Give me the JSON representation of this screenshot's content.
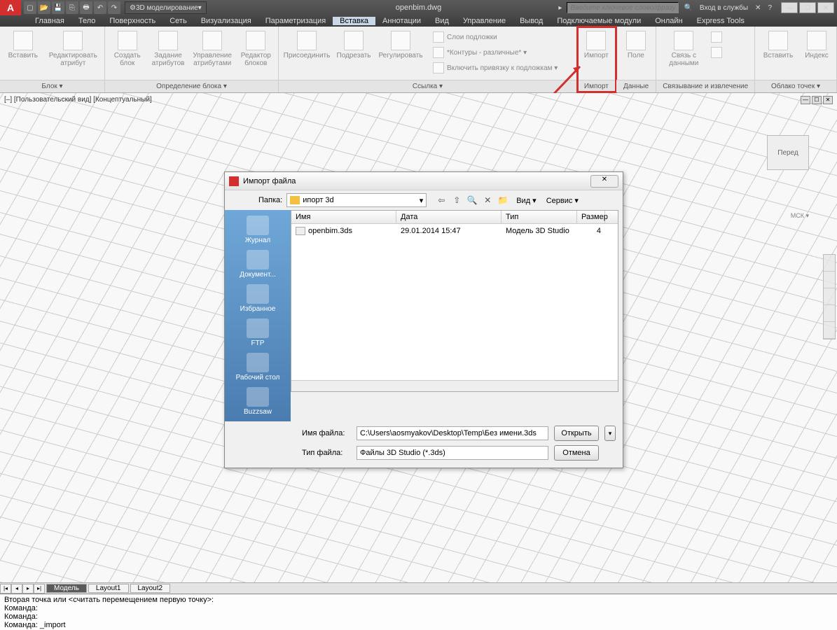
{
  "title": "openbim.dwg",
  "workspace": "3D моделирование",
  "search_placeholder": "Введите ключевое слово/фразу",
  "signin": "Вход в службы",
  "menu": [
    "Главная",
    "Тело",
    "Поверхность",
    "Сеть",
    "Визуализация",
    "Параметризация",
    "Вставка",
    "Аннотации",
    "Вид",
    "Управление",
    "Вывод",
    "Подключаемые модули",
    "Онлайн",
    "Express Tools"
  ],
  "active_menu": 6,
  "panels": {
    "block": {
      "title": "Блок ▾",
      "items": [
        "Вставить",
        "Редактировать атрибут"
      ]
    },
    "blockdef": {
      "title": "Определение блока ▾",
      "items": [
        "Создать блок",
        "Задание атрибутов",
        "Управление атрибутами",
        "Редактор блоков"
      ]
    },
    "ref": {
      "title": "Ссылка ▾",
      "items": [
        "Присоединить",
        "Подрезать",
        "Регулировать"
      ],
      "rows": [
        "Слои подложки",
        "*Контуры - различные* ▾",
        "Включить привязку к подложкам ▾"
      ]
    },
    "import": {
      "title": "Импорт",
      "item": "Импорт"
    },
    "data": {
      "title": "Данные",
      "item": "Поле"
    },
    "link": {
      "title": "Связывание и извлечение",
      "item": "Связь с данными"
    },
    "cloud": {
      "title": "Облако точек ▾",
      "items": [
        "Вставить",
        "Индекс"
      ]
    }
  },
  "viewport_label": "[–] [Пользовательский вид] [Концептуальный]",
  "viewcube": "Перед",
  "wcs": "МСК ▾",
  "dialog": {
    "title": "Импорт файла",
    "folder_label": "Папка:",
    "folder": "ипорт 3d",
    "view": "Вид",
    "service": "Сервис",
    "places": [
      "Журнал",
      "Документ...",
      "Избранное",
      "FTP",
      "Рабочий стол",
      "Buzzsaw"
    ],
    "cols": {
      "name": "Имя",
      "date": "Дата",
      "type": "Тип",
      "size": "Размер"
    },
    "rows": [
      {
        "name": "openbim.3ds",
        "date": "29.01.2014 15:47",
        "type": "Модель 3D Studio",
        "size": "4"
      }
    ],
    "filename_label": "Имя файла:",
    "filename": "C:\\Users\\aosmyakov\\Desktop\\Temp\\Без имени.3ds",
    "filetype_label": "Тип файла:",
    "filetype": "Файлы 3D Studio (*.3ds)",
    "open": "Открыть",
    "cancel": "Отмена"
  },
  "layout_tabs": [
    "Модель",
    "Layout1",
    "Layout2"
  ],
  "cmd": [
    "Вторая точка или <считать перемещением первую точку>:",
    "Команда:",
    "Команда:",
    "Команда: _import"
  ]
}
